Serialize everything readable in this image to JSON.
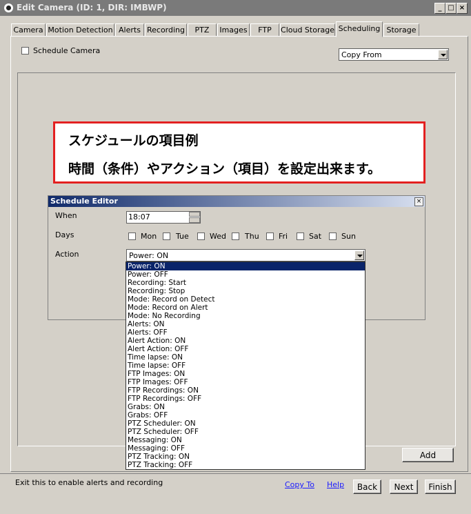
{
  "window": {
    "title": "Edit Camera (ID: 1, DIR: IMBWP)"
  },
  "tabs": [
    "Camera",
    "Motion Detection",
    "Alerts",
    "Recording",
    "PTZ",
    "Images",
    "FTP",
    "Cloud Storage",
    "Scheduling",
    "Storage"
  ],
  "active_tab": "Scheduling",
  "schedule": {
    "checkbox_label": "Schedule Camera",
    "copy_from": "Copy From"
  },
  "annotation": {
    "line1": "スケジュールの項目例",
    "line2": "時間（条件）やアクション（項目）を設定出来ます。",
    "border_color": "#e32020"
  },
  "editor": {
    "title": "Schedule Editor",
    "when_label": "When",
    "when_value": "18:07",
    "days_label": "Days",
    "days": [
      "Mon",
      "Tue",
      "Wed",
      "Thu",
      "Fri",
      "Sat",
      "Sun"
    ],
    "action_label": "Action",
    "action_value": "Power: ON",
    "action_options": [
      "Power: ON",
      "Power: OFF",
      "Recording: Start",
      "Recording: Stop",
      "Mode: Record on Detect",
      "Mode: Record on Alert",
      "Mode: No Recording",
      "Alerts: ON",
      "Alerts: OFF",
      "Alert Action: ON",
      "Alert Action: OFF",
      "Time lapse: ON",
      "Time lapse: OFF",
      "FTP Images: ON",
      "FTP Images: OFF",
      "FTP Recordings: ON",
      "FTP Recordings: OFF",
      "Grabs: ON",
      "Grabs: OFF",
      "PTZ Scheduler: ON",
      "PTZ Scheduler: OFF",
      "Messaging: ON",
      "Messaging: OFF",
      "PTZ Tracking: ON",
      "PTZ Tracking: OFF"
    ]
  },
  "buttons": {
    "add": "Add",
    "back": "Back",
    "next": "Next",
    "finish": "Finish"
  },
  "links": {
    "copy_to": "Copy To",
    "help": "Help"
  },
  "status_text": "Exit this to enable alerts and recording",
  "colors": {
    "selection": "#0a246a",
    "link": "#1a1aff"
  }
}
